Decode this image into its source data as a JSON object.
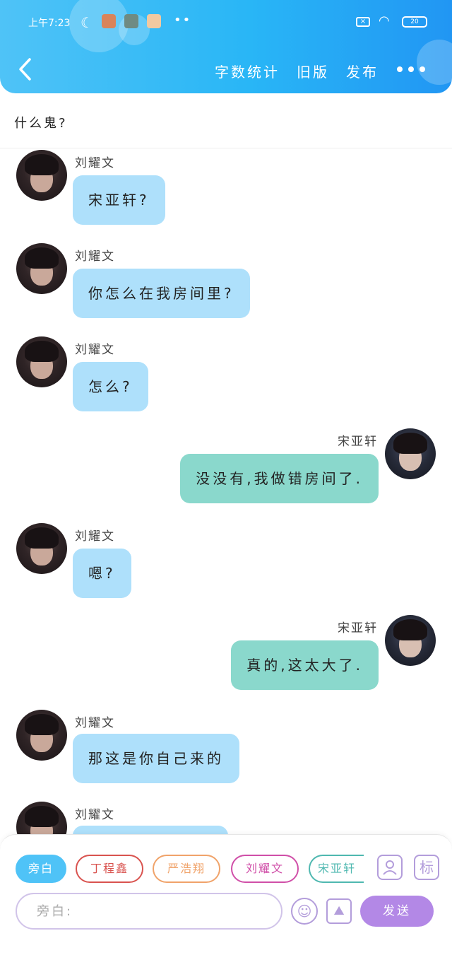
{
  "status_bar": {
    "time": "上午7:23",
    "battery": "20"
  },
  "nav": {
    "word_count": "字数统计",
    "old_version": "旧版",
    "publish": "发布"
  },
  "title": "什么鬼?",
  "messages": [
    {
      "side": "left",
      "name": "刘耀文",
      "text": "宋亚轩?"
    },
    {
      "side": "left",
      "name": "刘耀文",
      "text": "你怎么在我房间里?"
    },
    {
      "side": "left",
      "name": "刘耀文",
      "text": "怎么?"
    },
    {
      "side": "right",
      "name": "宋亚轩",
      "text": "没没有,我做错房间了."
    },
    {
      "side": "left",
      "name": "刘耀文",
      "text": "嗯?"
    },
    {
      "side": "right",
      "name": "宋亚轩",
      "text": "真的,这太大了."
    },
    {
      "side": "left",
      "name": "刘耀文",
      "text": "那这是你自己来的"
    },
    {
      "side": "left",
      "name": "刘耀文",
      "text": ""
    }
  ],
  "characters": [
    {
      "label": "旁白",
      "color": "#4fc3f7"
    },
    {
      "label": "丁程鑫",
      "color": "#d9534f"
    },
    {
      "label": "严浩翔",
      "color": "#f0a36a"
    },
    {
      "label": "刘耀文",
      "color": "#d04fa8"
    },
    {
      "label": "宋亚轩",
      "color": "#4fb8b0"
    }
  ],
  "tools": {
    "add_character_icon": "person-add-icon",
    "tag_icon": "标"
  },
  "composer": {
    "placeholder": "旁白:",
    "send": "发送"
  }
}
